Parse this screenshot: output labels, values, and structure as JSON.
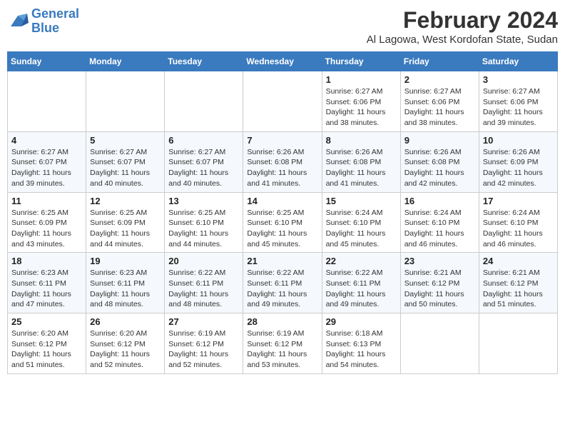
{
  "header": {
    "logo_line1": "General",
    "logo_line2": "Blue",
    "month_year": "February 2024",
    "location": "Al Lagowa, West Kordofan State, Sudan"
  },
  "weekdays": [
    "Sunday",
    "Monday",
    "Tuesday",
    "Wednesday",
    "Thursday",
    "Friday",
    "Saturday"
  ],
  "weeks": [
    [
      {
        "day": "",
        "info": ""
      },
      {
        "day": "",
        "info": ""
      },
      {
        "day": "",
        "info": ""
      },
      {
        "day": "",
        "info": ""
      },
      {
        "day": "1",
        "info": "Sunrise: 6:27 AM\nSunset: 6:06 PM\nDaylight: 11 hours\nand 38 minutes."
      },
      {
        "day": "2",
        "info": "Sunrise: 6:27 AM\nSunset: 6:06 PM\nDaylight: 11 hours\nand 38 minutes."
      },
      {
        "day": "3",
        "info": "Sunrise: 6:27 AM\nSunset: 6:06 PM\nDaylight: 11 hours\nand 39 minutes."
      }
    ],
    [
      {
        "day": "4",
        "info": "Sunrise: 6:27 AM\nSunset: 6:07 PM\nDaylight: 11 hours\nand 39 minutes."
      },
      {
        "day": "5",
        "info": "Sunrise: 6:27 AM\nSunset: 6:07 PM\nDaylight: 11 hours\nand 40 minutes."
      },
      {
        "day": "6",
        "info": "Sunrise: 6:27 AM\nSunset: 6:07 PM\nDaylight: 11 hours\nand 40 minutes."
      },
      {
        "day": "7",
        "info": "Sunrise: 6:26 AM\nSunset: 6:08 PM\nDaylight: 11 hours\nand 41 minutes."
      },
      {
        "day": "8",
        "info": "Sunrise: 6:26 AM\nSunset: 6:08 PM\nDaylight: 11 hours\nand 41 minutes."
      },
      {
        "day": "9",
        "info": "Sunrise: 6:26 AM\nSunset: 6:08 PM\nDaylight: 11 hours\nand 42 minutes."
      },
      {
        "day": "10",
        "info": "Sunrise: 6:26 AM\nSunset: 6:09 PM\nDaylight: 11 hours\nand 42 minutes."
      }
    ],
    [
      {
        "day": "11",
        "info": "Sunrise: 6:25 AM\nSunset: 6:09 PM\nDaylight: 11 hours\nand 43 minutes."
      },
      {
        "day": "12",
        "info": "Sunrise: 6:25 AM\nSunset: 6:09 PM\nDaylight: 11 hours\nand 44 minutes."
      },
      {
        "day": "13",
        "info": "Sunrise: 6:25 AM\nSunset: 6:10 PM\nDaylight: 11 hours\nand 44 minutes."
      },
      {
        "day": "14",
        "info": "Sunrise: 6:25 AM\nSunset: 6:10 PM\nDaylight: 11 hours\nand 45 minutes."
      },
      {
        "day": "15",
        "info": "Sunrise: 6:24 AM\nSunset: 6:10 PM\nDaylight: 11 hours\nand 45 minutes."
      },
      {
        "day": "16",
        "info": "Sunrise: 6:24 AM\nSunset: 6:10 PM\nDaylight: 11 hours\nand 46 minutes."
      },
      {
        "day": "17",
        "info": "Sunrise: 6:24 AM\nSunset: 6:10 PM\nDaylight: 11 hours\nand 46 minutes."
      }
    ],
    [
      {
        "day": "18",
        "info": "Sunrise: 6:23 AM\nSunset: 6:11 PM\nDaylight: 11 hours\nand 47 minutes."
      },
      {
        "day": "19",
        "info": "Sunrise: 6:23 AM\nSunset: 6:11 PM\nDaylight: 11 hours\nand 48 minutes."
      },
      {
        "day": "20",
        "info": "Sunrise: 6:22 AM\nSunset: 6:11 PM\nDaylight: 11 hours\nand 48 minutes."
      },
      {
        "day": "21",
        "info": "Sunrise: 6:22 AM\nSunset: 6:11 PM\nDaylight: 11 hours\nand 49 minutes."
      },
      {
        "day": "22",
        "info": "Sunrise: 6:22 AM\nSunset: 6:11 PM\nDaylight: 11 hours\nand 49 minutes."
      },
      {
        "day": "23",
        "info": "Sunrise: 6:21 AM\nSunset: 6:12 PM\nDaylight: 11 hours\nand 50 minutes."
      },
      {
        "day": "24",
        "info": "Sunrise: 6:21 AM\nSunset: 6:12 PM\nDaylight: 11 hours\nand 51 minutes."
      }
    ],
    [
      {
        "day": "25",
        "info": "Sunrise: 6:20 AM\nSunset: 6:12 PM\nDaylight: 11 hours\nand 51 minutes."
      },
      {
        "day": "26",
        "info": "Sunrise: 6:20 AM\nSunset: 6:12 PM\nDaylight: 11 hours\nand 52 minutes."
      },
      {
        "day": "27",
        "info": "Sunrise: 6:19 AM\nSunset: 6:12 PM\nDaylight: 11 hours\nand 52 minutes."
      },
      {
        "day": "28",
        "info": "Sunrise: 6:19 AM\nSunset: 6:12 PM\nDaylight: 11 hours\nand 53 minutes."
      },
      {
        "day": "29",
        "info": "Sunrise: 6:18 AM\nSunset: 6:13 PM\nDaylight: 11 hours\nand 54 minutes."
      },
      {
        "day": "",
        "info": ""
      },
      {
        "day": "",
        "info": ""
      }
    ]
  ]
}
